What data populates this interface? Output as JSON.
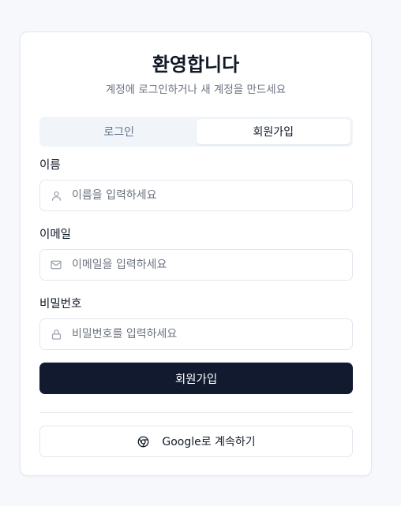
{
  "header": {
    "title": "환영합니다",
    "subtitle": "계정에 로그인하거나 새 계정을 만드세요"
  },
  "tabs": [
    {
      "label": "로그인",
      "active": false
    },
    {
      "label": "회원가입",
      "active": true
    }
  ],
  "form": {
    "name": {
      "label": "이름",
      "placeholder": "이름을 입력하세요",
      "value": "",
      "icon": "user-icon"
    },
    "email": {
      "label": "이메일",
      "placeholder": "이메일을 입력하세요",
      "value": "",
      "icon": "mail-icon"
    },
    "password": {
      "label": "비밀번호",
      "placeholder": "비밀번호를 입력하세요",
      "value": "",
      "icon": "lock-icon"
    },
    "submit_label": "회원가입"
  },
  "social": {
    "google_label": "Google로 계속하기",
    "icon": "chrome-icon"
  },
  "colors": {
    "primary_button": "#111a2e",
    "accent_dot": "#ef4444"
  }
}
